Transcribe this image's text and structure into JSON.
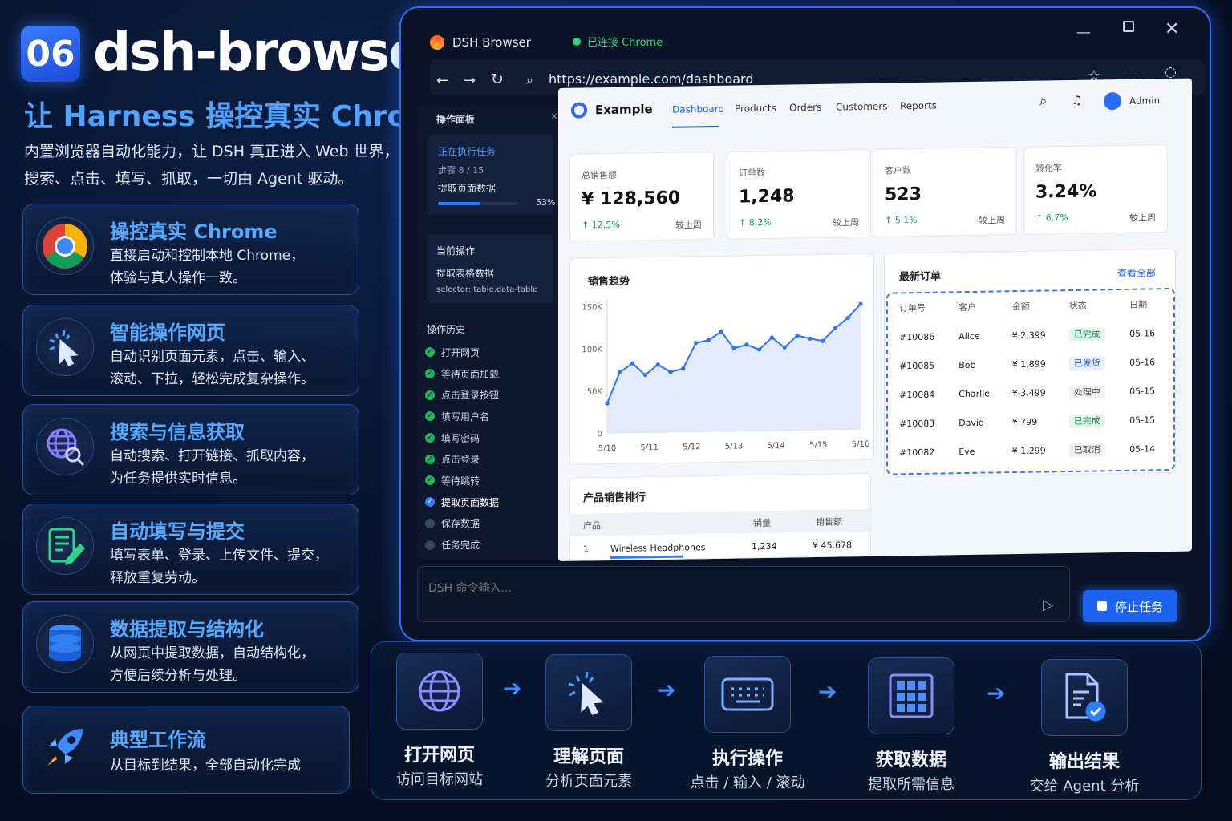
{
  "badge": "06",
  "title": "dsh-browser",
  "subtitle": "让 Harness 操控真实 Chrome",
  "desc_line1": "内置浏览器自动化能力，让 DSH 真正进入 Web 世界，",
  "desc_line2": "搜索、点击、填写、抓取，一切由 Agent 驱动。",
  "features": [
    {
      "title": "操控真实 Chrome",
      "l1": "直接启动和控制本地 Chrome，",
      "l2": "体验与真人操作一致。",
      "icon": "chrome-icon"
    },
    {
      "title": "智能操作网页",
      "l1": "自动识别页面元素，点击、输入、",
      "l2": "滚动、下拉，轻松完成复杂操作。",
      "icon": "cursor-click-icon"
    },
    {
      "title": "搜索与信息获取",
      "l1": "自动搜索、打开链接、抓取内容，",
      "l2": "为任务提供实时信息。",
      "icon": "globe-search-icon"
    },
    {
      "title": "自动填写与提交",
      "l1": "填写表单、登录、上传文件、提交，",
      "l2": "释放重复劳动。",
      "icon": "form-edit-icon"
    },
    {
      "title": "数据提取与结构化",
      "l1": "从网页中提取数据，自动结构化，",
      "l2": "方便后续分析与处理。",
      "icon": "database-icon"
    },
    {
      "title": "典型工作流",
      "l1": "从目标到结果，全部自动化完成",
      "l2": "",
      "icon": "rocket-icon"
    }
  ],
  "browser": {
    "tab_title": "DSH Browser",
    "connection": "已连接 Chrome",
    "url": "https://example.com/dashboard",
    "panel": {
      "title": "操作面板",
      "close": "×",
      "task_title": "正在执行任务",
      "task_step": "步骤 8 / 15",
      "task_name": "提取页面数据",
      "progress": 0.53,
      "progress_label": "53%",
      "current_title": "当前操作",
      "current_action": "提取表格数据",
      "current_selector": "selector: table.data-table",
      "history_title": "操作历史",
      "history": [
        {
          "label": "打开网页",
          "state": "done"
        },
        {
          "label": "等待页面加载",
          "state": "done"
        },
        {
          "label": "点击登录按钮",
          "state": "done"
        },
        {
          "label": "填写用户名",
          "state": "done"
        },
        {
          "label": "填写密码",
          "state": "done"
        },
        {
          "label": "点击登录",
          "state": "done"
        },
        {
          "label": "等待跳转",
          "state": "done"
        },
        {
          "label": "提取页面数据",
          "state": "active"
        },
        {
          "label": "保存数据",
          "state": "pending"
        },
        {
          "label": "任务完成",
          "state": "pending"
        }
      ]
    },
    "command_placeholder": "DSH 命令输入...",
    "stop_label": "停止任务"
  },
  "dashboard": {
    "brand": "Example",
    "nav": [
      "Dashboard",
      "Products",
      "Orders",
      "Customers",
      "Reports"
    ],
    "user": "Admin",
    "kpis": [
      {
        "label": "总销售额",
        "value": "¥ 128,560",
        "growth": "↑ 12.5%",
        "compare": "较上周"
      },
      {
        "label": "订单数",
        "value": "1,248",
        "growth": "↑ 8.2%",
        "compare": "较上周"
      },
      {
        "label": "客户数",
        "value": "523",
        "growth": "↑ 5.1%",
        "compare": "较上周"
      },
      {
        "label": "转化率",
        "value": "3.24%",
        "growth": "↑ 6.7%",
        "compare": "较上周"
      }
    ],
    "trend_title": "销售趋势",
    "orders_title": "最新订单",
    "orders_link": "查看全部",
    "orders_headers": [
      "订单号",
      "客户",
      "金额",
      "状态",
      "日期"
    ],
    "orders": [
      [
        "#10086",
        "Alice",
        "¥ 2,399",
        "已完成",
        "05-16"
      ],
      [
        "#10085",
        "Bob",
        "¥ 1,899",
        "已发货",
        "05-16"
      ],
      [
        "#10084",
        "Charlie",
        "¥ 3,499",
        "处理中",
        "05-15"
      ],
      [
        "#10083",
        "David",
        "¥ 799",
        "已完成",
        "05-15"
      ],
      [
        "#10082",
        "Eve",
        "¥ 1,299",
        "已取消",
        "05-14"
      ]
    ],
    "rank_title": "产品销售排行",
    "rank_headers": [
      "产品",
      "销量",
      "销售额"
    ],
    "rank_rows": [
      [
        "1",
        "Wireless Headphones",
        "1,234",
        "¥ 45,678"
      ]
    ]
  },
  "chart_data": {
    "type": "line",
    "title": "销售趋势",
    "categories": [
      "5/10",
      "5/11",
      "5/12",
      "5/13",
      "5/14",
      "5/15",
      "5/16"
    ],
    "yticks": [
      "0",
      "50K",
      "100K",
      "150K"
    ],
    "ylim": [
      0,
      150000
    ],
    "x": [
      0,
      0.3,
      0.6,
      0.9,
      1.2,
      1.5,
      1.8,
      2.1,
      2.4,
      2.7,
      3.0,
      3.3,
      3.6,
      3.9,
      4.2,
      4.5,
      4.8,
      5.1,
      5.4,
      5.7,
      6.0
    ],
    "values": [
      35000,
      72000,
      82000,
      68000,
      80000,
      71000,
      75000,
      105000,
      108000,
      118000,
      98000,
      102000,
      96000,
      110000,
      98000,
      112000,
      108000,
      105000,
      120000,
      132000,
      148000
    ]
  },
  "workflow": [
    {
      "title": "打开网页",
      "sub": "访问目标网站",
      "icon": "globe-icon"
    },
    {
      "title": "理解页面",
      "sub": "分析页面元素",
      "icon": "cursor-click-icon"
    },
    {
      "title": "执行操作",
      "sub": "点击 / 输入 / 滚动",
      "icon": "keyboard-icon"
    },
    {
      "title": "获取数据",
      "sub": "提取所需信息",
      "icon": "grid-data-icon"
    },
    {
      "title": "输出结果",
      "sub": "交给 Agent 分析",
      "icon": "document-check-icon"
    }
  ],
  "colors": {
    "accent": "#3f8cff",
    "success": "#1fb35f",
    "brand": "#1e62f0"
  }
}
